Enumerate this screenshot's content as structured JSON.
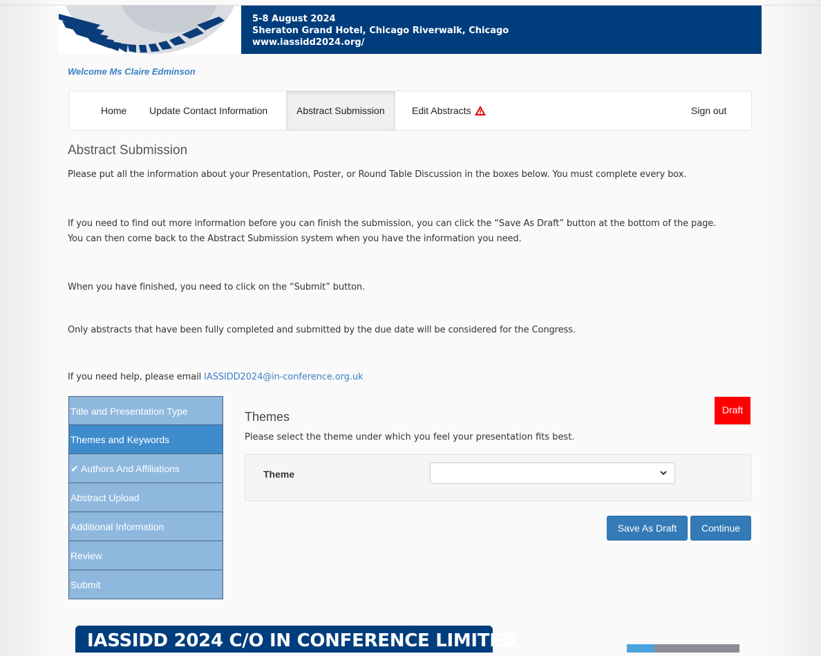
{
  "banner": {
    "dates": "5-8 August 2024",
    "venue": "Sheraton Grand Hotel, Chicago Riverwalk, Chicago",
    "website": "www.iassidd2024.org/"
  },
  "welcome": "Welcome Ms Claire Edminson",
  "nav": {
    "items": [
      {
        "label": "Home"
      },
      {
        "label": "Update Contact Information"
      },
      {
        "label": "Abstract Submission",
        "active": true
      },
      {
        "label": "Edit Abstracts",
        "icon": "warning-icon"
      }
    ],
    "signout": "Sign out"
  },
  "page_title": "Abstract Submission",
  "intro": {
    "p1": "Please put all the information about your Presentation, Poster, or Round Table Discussion in the boxes below.  You must complete every box.",
    "p2a": "If you need to find out more information before you can finish the submission, you can click the “Save As Draft” button at the bottom of the page.",
    "p2b": "You can then come back to the Abstract Submission system when you have the information you need.",
    "p3": "When you have finished, you need to click on the “Submit” button.",
    "p4": "Only abstracts that have been fully completed and submitted by the due date will be considered for the Congress.",
    "p5": "If you need help, please email ",
    "email": "IASSIDD2024@in-conference.org.uk"
  },
  "steps": [
    {
      "label": "Title and Presentation Type"
    },
    {
      "label": "Themes and Keywords",
      "active": true
    },
    {
      "label": "Authors And Affiliations",
      "check": true
    },
    {
      "label": "Abstract Upload"
    },
    {
      "label": "Additional Information"
    },
    {
      "label": "Review"
    },
    {
      "label": "Submit"
    }
  ],
  "themes": {
    "title": "Themes",
    "status_badge": "Draft",
    "instruction": "Please select the theme under which you feel your presentation fits best.",
    "theme_label": "Theme",
    "theme_value": ""
  },
  "buttons": {
    "save_draft": "Save As Draft",
    "continue": "Continue"
  },
  "footer": {
    "org": "IASSIDD 2024 C/O IN CONFERENCE LIMITED"
  },
  "colors": {
    "brand_blue": "#003d7d",
    "link_blue": "#3b7fc4",
    "step_bg": "#8fb8df",
    "step_active": "#3f8ccd",
    "draft_red": "#ff0000",
    "button_blue": "#337ab7"
  }
}
